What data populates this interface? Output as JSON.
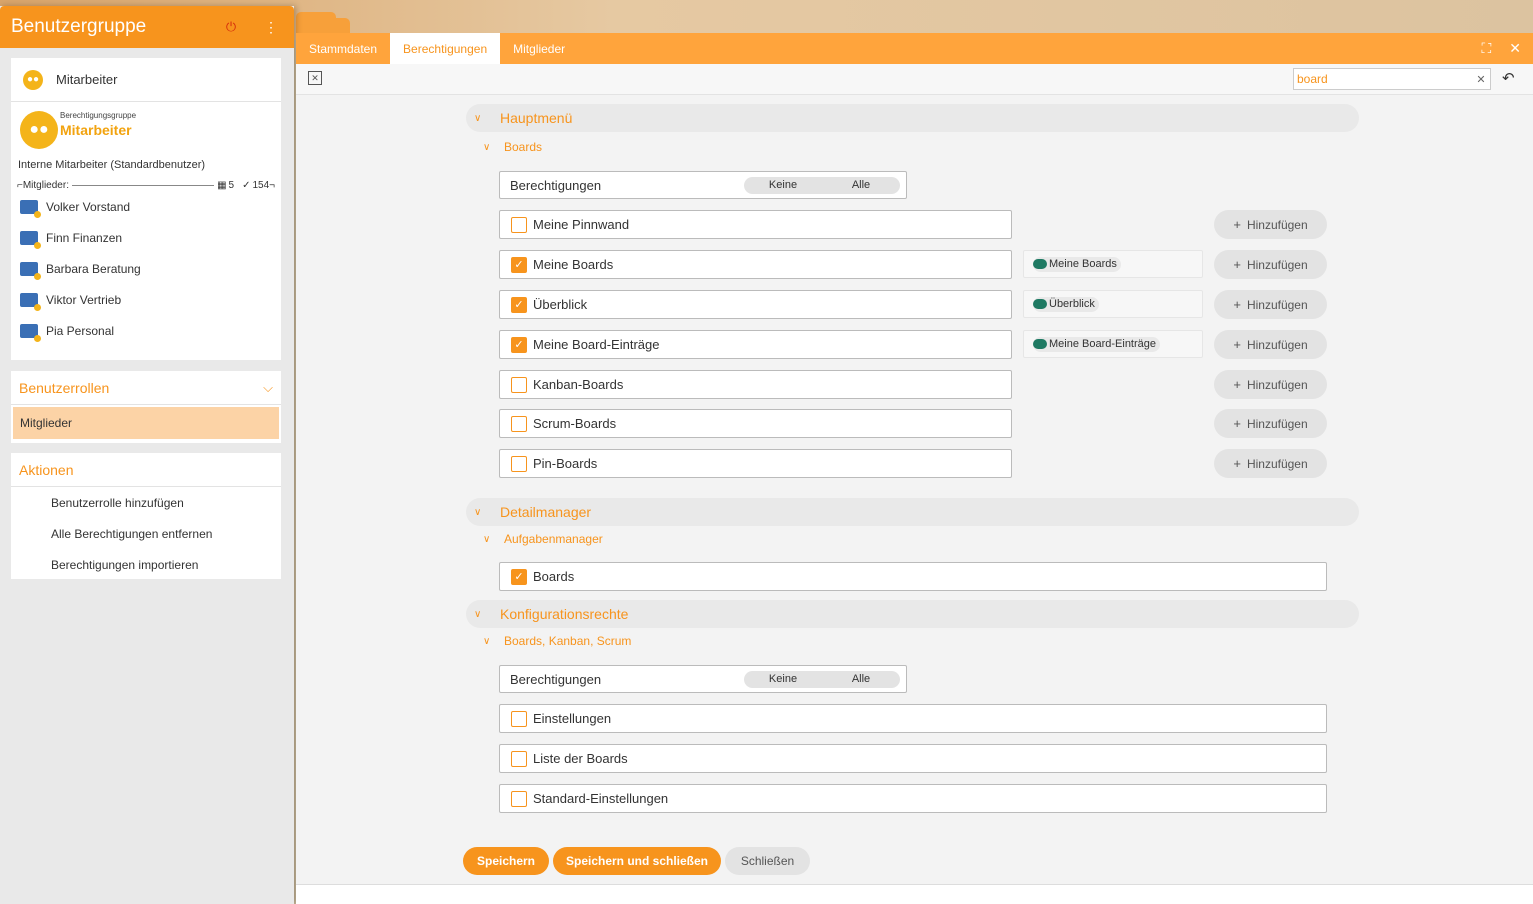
{
  "left_panel": {
    "title": "Benutzergruppe",
    "group_label": "Mitarbeiter",
    "group_type_label": "Berechtigungsgruppe",
    "group_name": "Mitarbeiter",
    "description": "Interne Mitarbeiter (Standardbenutzer)",
    "members_label": "Mitglieder:",
    "members_count_a": "5",
    "members_count_b": "154",
    "members": [
      "Volker Vorstand",
      "Finn Finanzen",
      "Barbara Beratung",
      "Viktor Vertrieb",
      "Pia Personal"
    ],
    "roles_title": "Benutzerrollen",
    "roles_item": "Mitglieder",
    "actions_title": "Aktionen",
    "actions": [
      "Benutzerrolle hinzufügen",
      "Alle Berechtigungen entfernen",
      "Berechtigungen importieren"
    ]
  },
  "tabs": [
    "Stammdaten",
    "Berechtigungen",
    "Mitglieder"
  ],
  "active_tab": "Berechtigungen",
  "search": {
    "value": "board"
  },
  "sections": [
    {
      "title": "Hauptmenü",
      "subsection": "Boards",
      "perm_label": "Berechtigungen",
      "toggle": [
        "Keine",
        "Alle"
      ],
      "rows": [
        {
          "label": "Meine Pinnwand",
          "checked": false,
          "tag": ""
        },
        {
          "label": "Meine Boards",
          "checked": true,
          "tag": "Meine Boards"
        },
        {
          "label": "Überblick",
          "checked": true,
          "tag": "Überblick"
        },
        {
          "label": "Meine Board-Einträge",
          "checked": true,
          "tag": "Meine Board-Einträge"
        },
        {
          "label": "Kanban-Boards",
          "checked": false,
          "tag": ""
        },
        {
          "label": "Scrum-Boards",
          "checked": false,
          "tag": ""
        },
        {
          "label": "Pin-Boards",
          "checked": false,
          "tag": ""
        }
      ],
      "add_label": "Hinzufügen"
    },
    {
      "title": "Detailmanager",
      "subsection": "Aufgabenmanager",
      "rows": [
        {
          "label": "Boards",
          "checked": true
        }
      ]
    },
    {
      "title": "Konfigurationsrechte",
      "subsection": "Boards, Kanban, Scrum",
      "perm_label": "Berechtigungen",
      "toggle": [
        "Keine",
        "Alle"
      ],
      "rows": [
        {
          "label": "Einstellungen",
          "checked": false
        },
        {
          "label": "Liste der Boards",
          "checked": false
        },
        {
          "label": "Standard-Einstellungen",
          "checked": false
        }
      ]
    }
  ],
  "footer": {
    "save": "Speichern",
    "save_close": "Speichern und schließen",
    "close": "Schließen"
  },
  "colors": {
    "accent": "#f7941d",
    "tag_dot": "#1f7a63"
  }
}
